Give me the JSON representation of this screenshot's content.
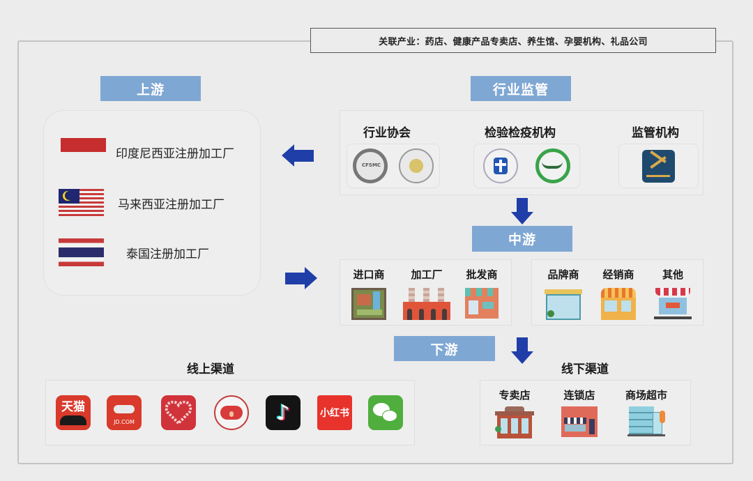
{
  "related_industries": "关联产业：药店、健康产品专卖店、养生馆、孕婴机构、礼品公司",
  "stages": {
    "upstream": "上游",
    "regulation": "行业监管",
    "midstream": "中游",
    "downstream": "下游"
  },
  "upstream": {
    "items": [
      {
        "flag": "indonesia-flag",
        "label": "印度尼西亚注册加工厂"
      },
      {
        "flag": "malaysia-flag",
        "label": "马来西亚注册加工厂"
      },
      {
        "flag": "thailand-flag",
        "label": "泰国注册加工厂"
      }
    ]
  },
  "regulation": {
    "groups": [
      {
        "title": "行业协会",
        "logos": [
          "cfsmc-association-logo",
          "association-seal-logo"
        ]
      },
      {
        "title": "检验检疫机构",
        "logos": [
          "inspection-cross-logo",
          "quarantine-green-logo"
        ]
      },
      {
        "title": "监管机构",
        "logos": [
          "china-customs-logo"
        ]
      }
    ]
  },
  "midstream": {
    "left": [
      {
        "label": "进口商",
        "icon": "importer-icon"
      },
      {
        "label": "加工厂",
        "icon": "factory-icon"
      },
      {
        "label": "批发商",
        "icon": "wholesaler-shop-icon"
      }
    ],
    "right": [
      {
        "label": "品牌商",
        "icon": "brand-store-icon"
      },
      {
        "label": "经销商",
        "icon": "dealer-shop-icon"
      },
      {
        "label": "其他",
        "icon": "open-shop-icon"
      }
    ]
  },
  "downstream": {
    "online": {
      "title": "线上渠道",
      "apps": [
        {
          "name": "tmall",
          "text": "天猫"
        },
        {
          "name": "jd",
          "text": "JD.COM"
        },
        {
          "name": "pinduoduo",
          "text": ""
        },
        {
          "name": "kaola",
          "text": ""
        },
        {
          "name": "douyin",
          "text": ""
        },
        {
          "name": "xiaohongshu",
          "text": "小红书"
        },
        {
          "name": "wechat",
          "text": ""
        }
      ]
    },
    "offline": {
      "title": "线下渠道",
      "items": [
        {
          "label": "专卖店",
          "icon": "specialty-store-icon"
        },
        {
          "label": "连锁店",
          "icon": "chain-store-icon"
        },
        {
          "label": "商场超市",
          "icon": "mall-supermarket-icon"
        }
      ]
    }
  },
  "colors": {
    "stage_tag": "#7fa7d3",
    "arrow": "#1f3ea8",
    "background": "#ececec"
  }
}
